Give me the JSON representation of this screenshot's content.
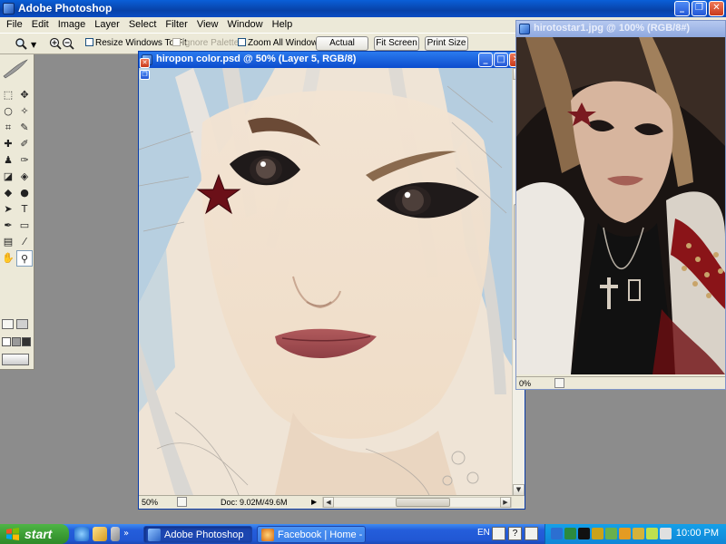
{
  "app": {
    "title": "Adobe Photoshop"
  },
  "menu": [
    "File",
    "Edit",
    "Image",
    "Layer",
    "Select",
    "Filter",
    "View",
    "Window",
    "Help"
  ],
  "options": {
    "resize_windows": "Resize Windows To Fit",
    "ignore_palettes": "Ignore Palettes",
    "zoom_all_windows": "Zoom All Windows",
    "actual_pixels": "Actual Pixels",
    "fit_screen": "Fit Screen",
    "print_size": "Print Size"
  },
  "toolbox": {
    "type_tool_glyph": "T",
    "foreground_color": "#1a86b4",
    "background_color": "#ffffff"
  },
  "doc_main": {
    "title": "hiropon color.psd @ 50% (Layer 5, RGB/8)",
    "zoom": "50%",
    "doc_size": "Doc: 9.02M/49.6M"
  },
  "doc_ref": {
    "title": "hirotostar1.jpg @ 100% (RGB/8#)",
    "zoom": "0%"
  },
  "taskbar": {
    "start": "start",
    "tasks": [
      "Adobe Photoshop",
      "Facebook | Home - lol..."
    ],
    "language": "EN",
    "clock": "10:00 PM"
  }
}
